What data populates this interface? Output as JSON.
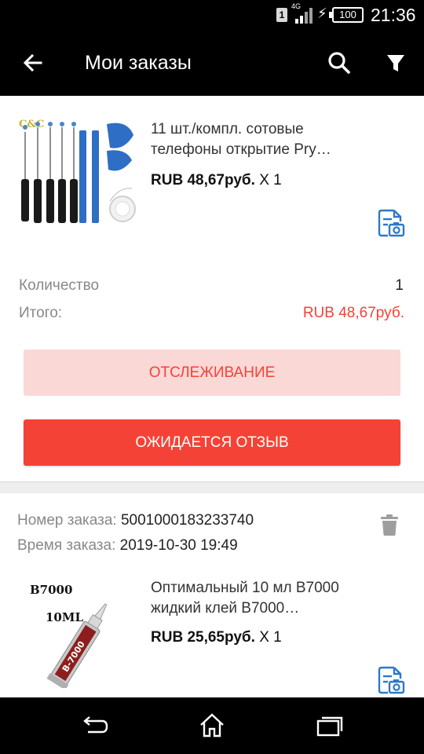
{
  "status_bar": {
    "sim": "1",
    "network": "4G",
    "battery": "100",
    "time": "21:36"
  },
  "app_bar": {
    "title": "Мои заказы",
    "icons": [
      "back-arrow-icon",
      "search-icon",
      "filter-icon"
    ]
  },
  "order1": {
    "product": {
      "title_line1": "11 шт./компл. сотовые",
      "title_line2": "телефоны открытие Pry…",
      "price": "RUB 48,67руб.",
      "quantity": "X 1",
      "image_label": "C&C"
    },
    "quantity_label": "Количество",
    "quantity_value": "1",
    "total_label": "Итого:",
    "total_value": "RUB 48,67руб.",
    "track_button": "ОТСЛЕЖИВАНИЕ",
    "review_button": "ОЖИДАЕТСЯ ОТЗЫВ"
  },
  "order2": {
    "number_label": "Номер заказа:",
    "number_value": "5001000183233740",
    "time_label": "Время заказа:",
    "time_value": "2019-10-30 19:49",
    "product": {
      "title_line1": "Оптимальный 10 мл B7000",
      "title_line2": "жидкий клей B7000…",
      "price": "RUB 25,65руб.",
      "quantity": "X 1",
      "image_label_1": "B7000",
      "image_label_2": "10ML",
      "image_tube_text": "B-7000"
    }
  },
  "colors": {
    "accent": "#f44336",
    "accent_light": "#fad8d6",
    "icon_blue": "#2d79c7",
    "muted_text": "#888888"
  }
}
